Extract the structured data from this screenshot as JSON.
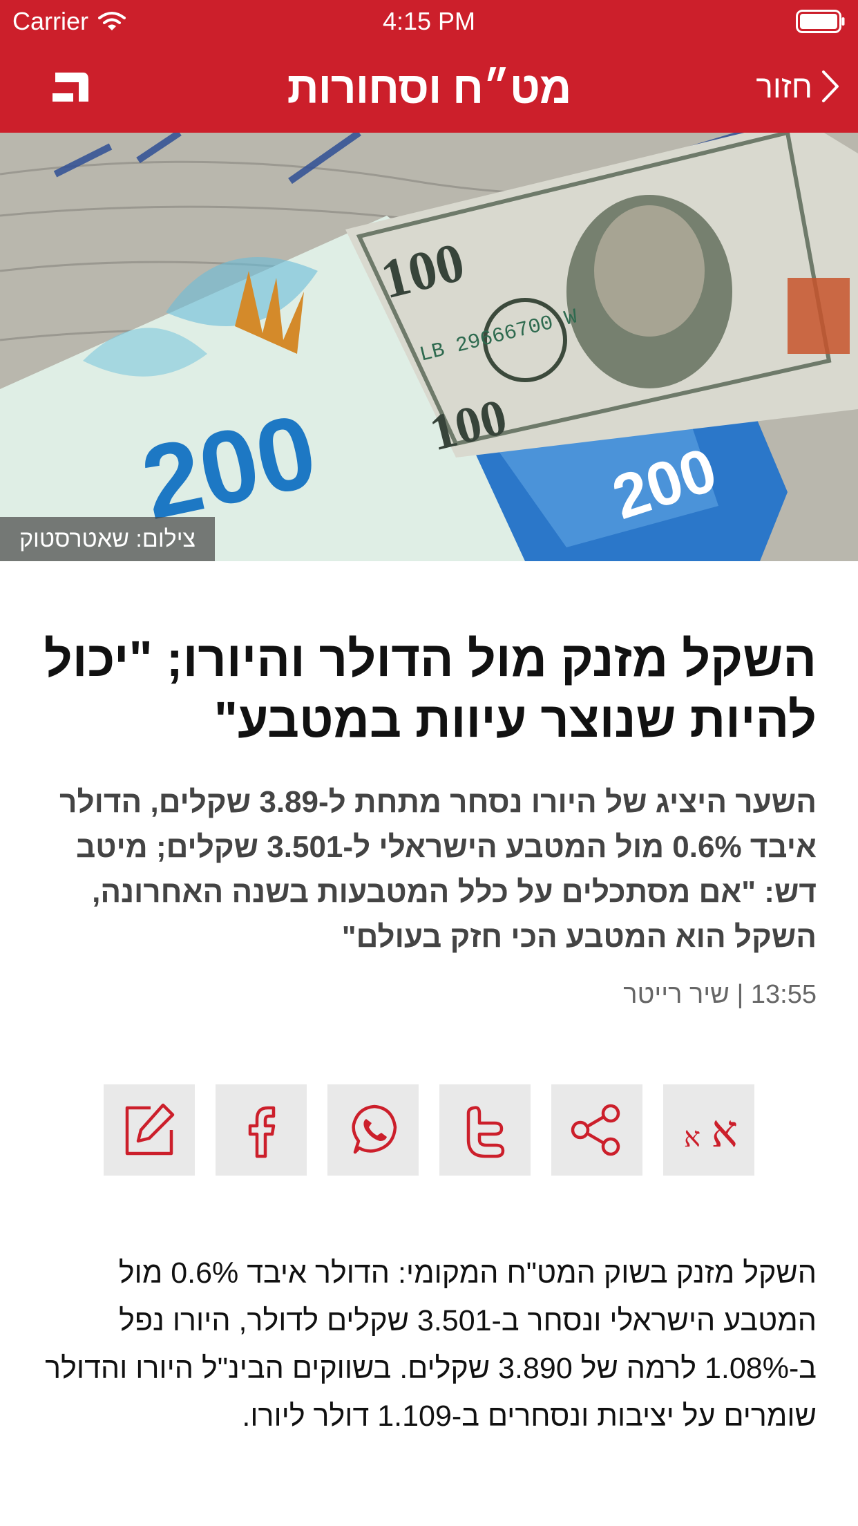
{
  "status_bar": {
    "carrier": "Carrier",
    "time": "4:15 PM"
  },
  "nav": {
    "title": "מט״ח וסחורות",
    "back_label": "חזור"
  },
  "colors": {
    "brand_red": "#cc1f2b",
    "icon_red": "#cc1f2b",
    "button_bg": "#e9e9e9"
  },
  "hero": {
    "credit": "צילום: שאטרסטוק"
  },
  "article": {
    "headline": "השקל מזנק מול הדולר והיורו; \"יכול להיות שנוצר עיוות במטבע\"",
    "subheadline": "השער היציג של היורו נסחר מתחת ל-3.89 שקלים, הדולר איבד 0.6% מול המטבע הישראלי ל-3.501 שקלים; מיטב דש: \"אם מסתכלים על כלל המטבעות בשנה האחרונה, השקל הוא המטבע הכי חזק בעולם\"",
    "byline": "13:55 | שיר רייטר",
    "body": "השקל מזנק בשוק המט\"ח המקומי: הדולר איבד 0.6% מול המטבע הישראלי ונסחר ב-3.501 שקלים לדולר, היורו נפל ב-1.08% לרמה של 3.890 שקלים. בשווקים הבינ\"ל היורו והדולר שומרים על יציבות ונסחרים ב-1.109 דולר ליורו."
  },
  "share_buttons": [
    {
      "icon": "font-size-icon"
    },
    {
      "icon": "share-icon"
    },
    {
      "icon": "twitter-icon"
    },
    {
      "icon": "whatsapp-icon"
    },
    {
      "icon": "facebook-icon"
    },
    {
      "icon": "talkback-edit-icon"
    }
  ]
}
